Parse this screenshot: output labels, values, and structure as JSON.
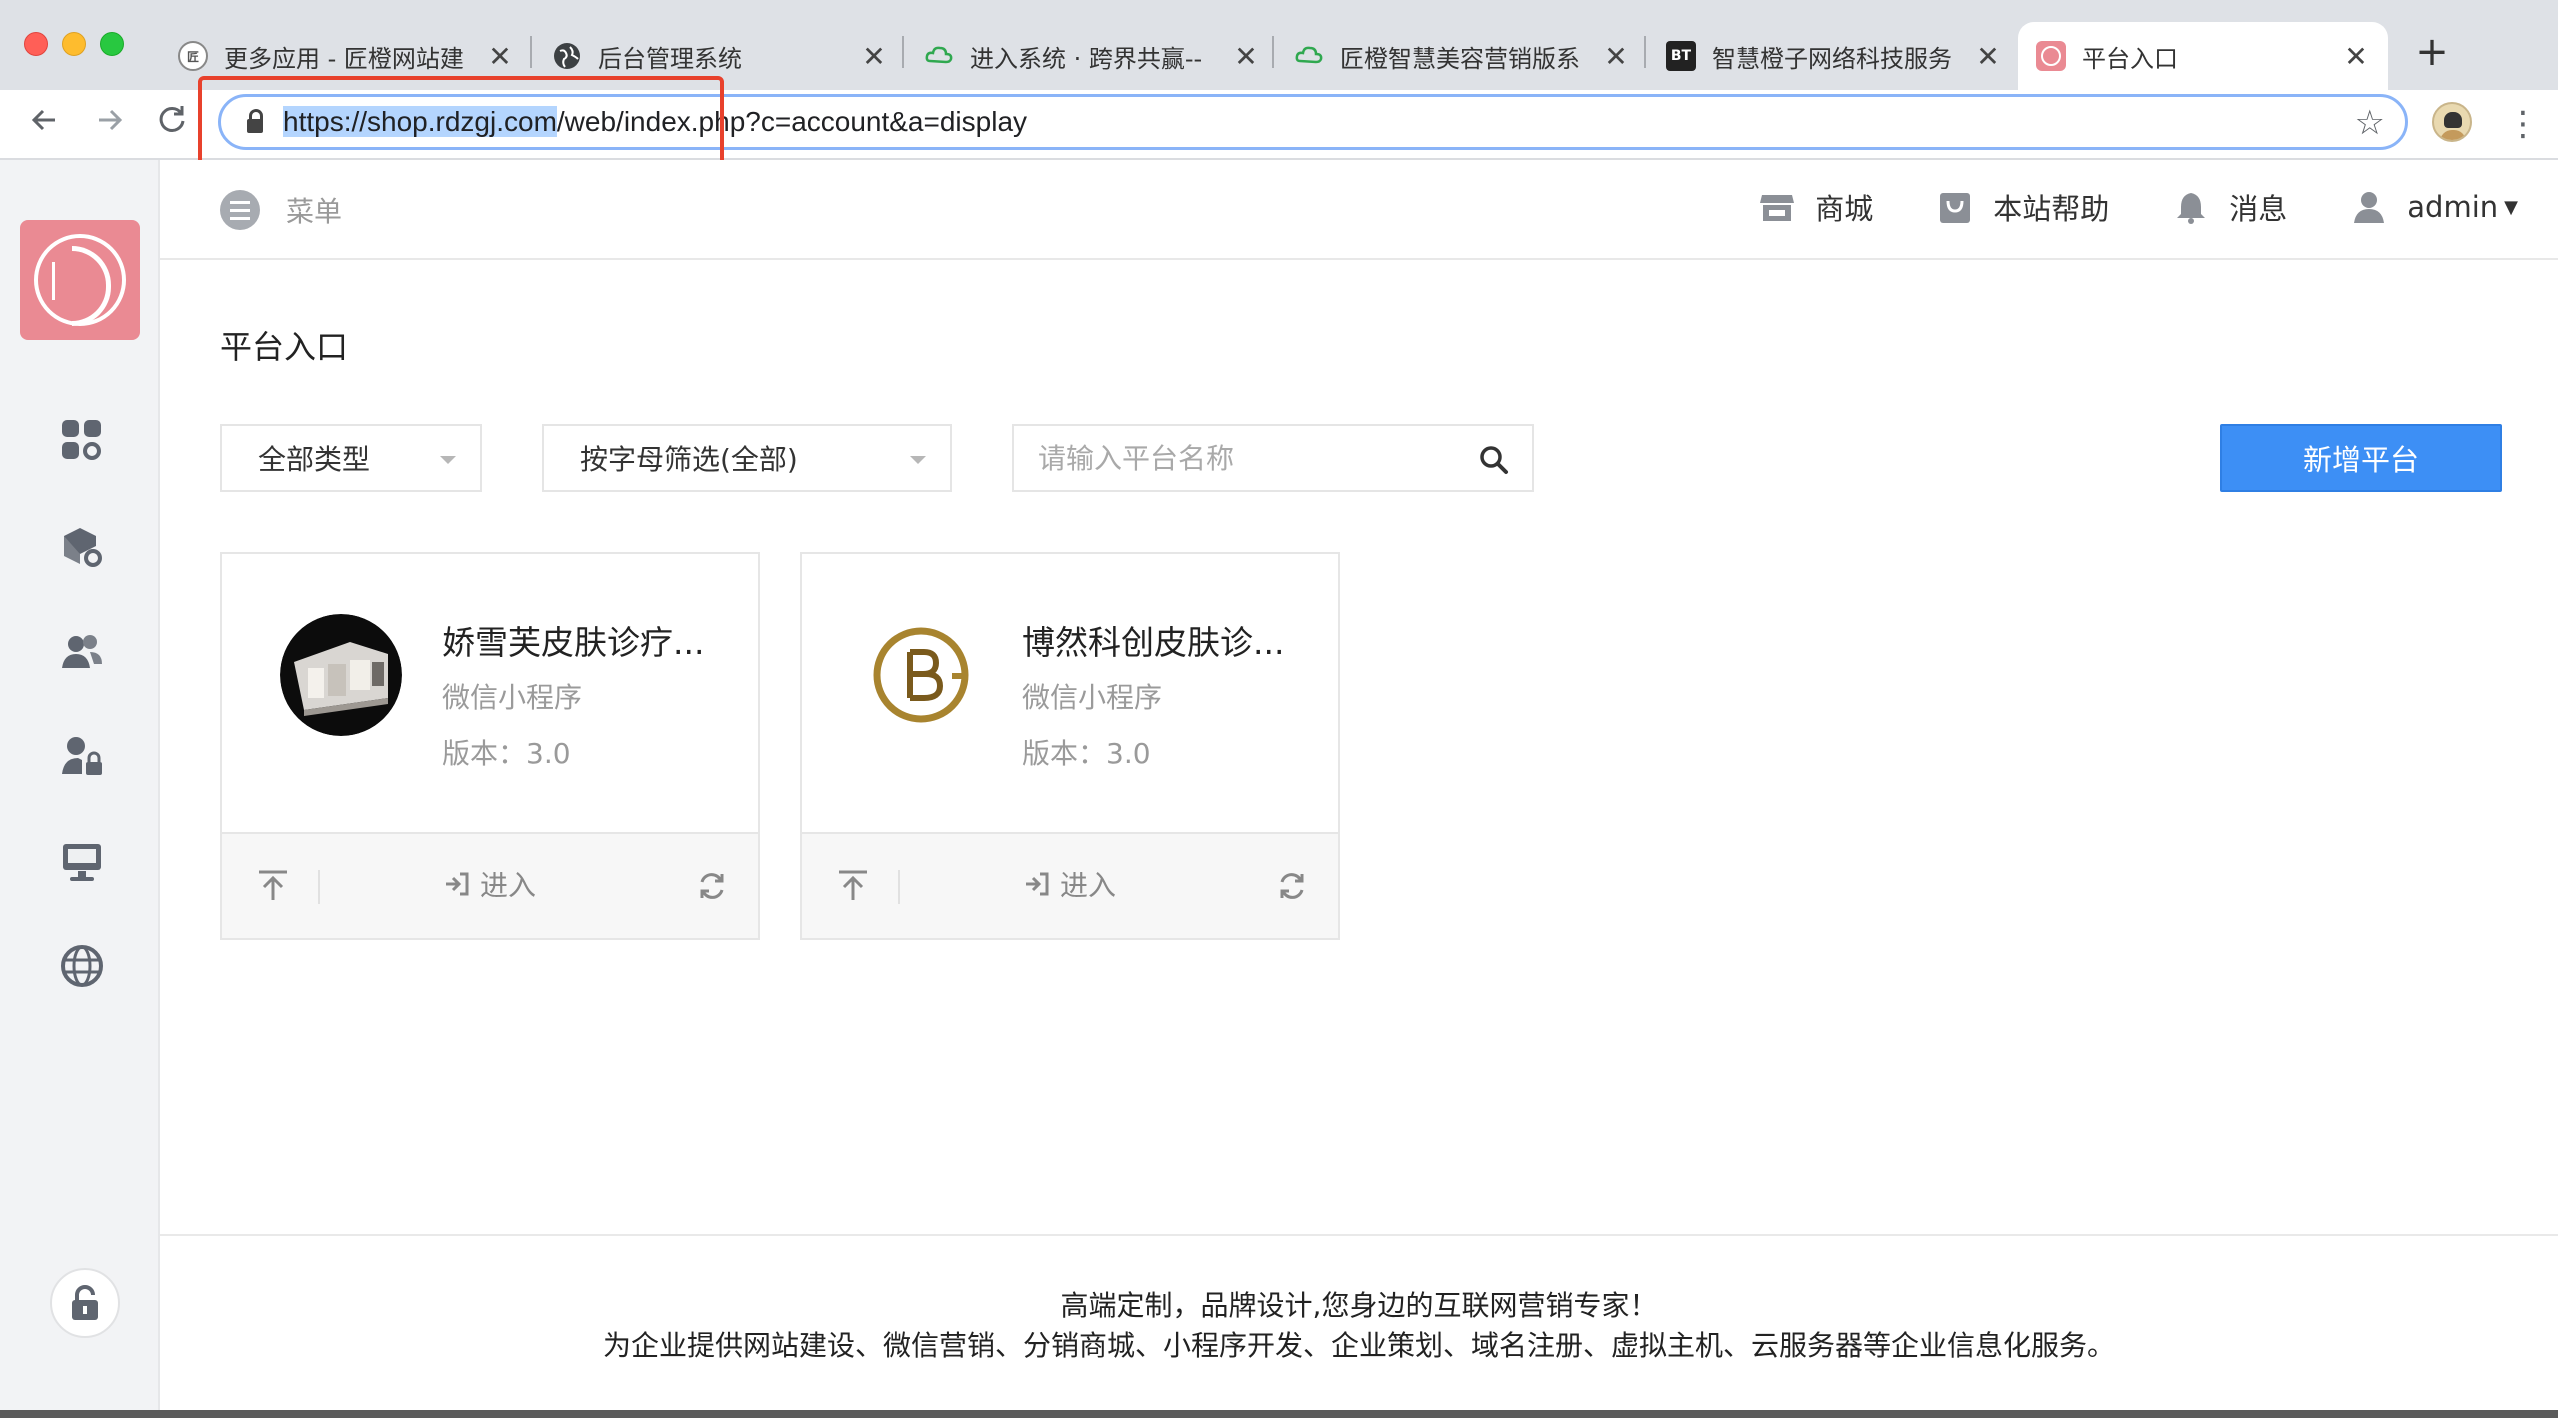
{
  "browser": {
    "tabs": [
      {
        "title": "更多应用 - 匠橙网站建",
        "icon": "jc-logo-icon"
      },
      {
        "title": "后台管理系统",
        "icon": "globe-icon"
      },
      {
        "title": "进入系统 · 跨界共赢--",
        "icon": "cloud-icon"
      },
      {
        "title": "匠橙智慧美容营销版系",
        "icon": "cloud-icon"
      },
      {
        "title": "智慧橙子网络科技服务",
        "icon": "bt-icon",
        "icon_text": "BT"
      },
      {
        "title": "平台入口",
        "icon": "pink-logo-icon",
        "active": true
      }
    ],
    "new_tab": "+",
    "close_glyph": "✕",
    "url_selected": "https://shop.rdzgj.com",
    "url_rest": "/web/index.php?c=account&a=display",
    "colors": {
      "highlight": "#e8412c",
      "selection": "#b4d5fe"
    }
  },
  "topbar": {
    "menu_label": "菜单",
    "links": [
      {
        "label": "商城",
        "icon": "store-icon"
      },
      {
        "label": "本站帮助",
        "icon": "help-bag-icon"
      },
      {
        "label": "消息",
        "icon": "bell-icon"
      },
      {
        "label": "admin",
        "icon": "user-icon"
      }
    ]
  },
  "page": {
    "title": "平台入口",
    "filters": {
      "type": "全部类型",
      "letter": "按字母筛选(全部)",
      "search_placeholder": "请输入平台名称"
    },
    "add_button": "新增平台",
    "accent": "#3d8ff5"
  },
  "cards": [
    {
      "name": "娇雪芙皮肤诊疗...",
      "kind": "微信小程序",
      "version": "版本：3.0",
      "enter": "进入"
    },
    {
      "name": "博然科创皮肤诊...",
      "kind": "微信小程序",
      "version": "版本：3.0",
      "enter": "进入"
    }
  ],
  "footer": {
    "line1": "高端定制，品牌设计,您身边的互联网营销专家！",
    "line2": "为企业提供网站建设、微信营销、分销商城、小程序开发、企业策划、域名注册、虚拟主机、云服务器等企业信息化服务。"
  }
}
